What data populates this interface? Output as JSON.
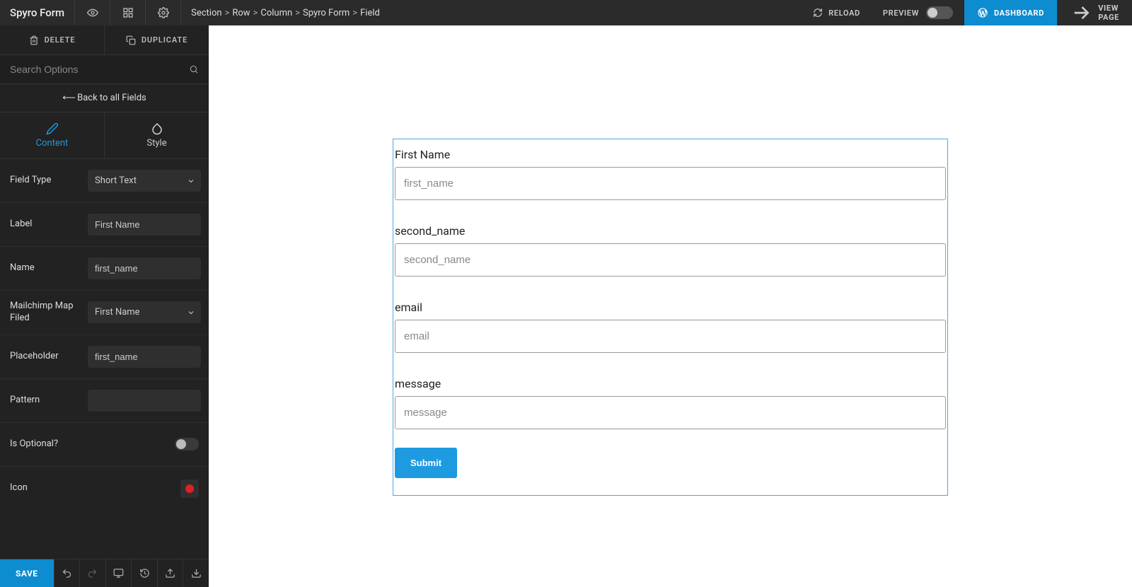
{
  "topbar": {
    "brand": "Spyro Form",
    "breadcrumb": [
      "Section",
      "Row",
      "Column",
      "Spyro Form",
      "Field"
    ],
    "reload": "RELOAD",
    "preview": "PREVIEW",
    "dashboard": "DASHBOARD",
    "view_page": "VIEW PAGE"
  },
  "sidebar": {
    "delete": "DELETE",
    "duplicate": "DUPLICATE",
    "search_placeholder": "Search Options",
    "back": "Back to all Fields",
    "tabs": {
      "content": "Content",
      "style": "Style"
    },
    "options": {
      "field_type": {
        "label": "Field Type",
        "value": "Short Text"
      },
      "label": {
        "label": "Label",
        "value": "First Name"
      },
      "name": {
        "label": "Name",
        "value": "first_name"
      },
      "mailchimp": {
        "label": "Mailchimp Map Filed",
        "value": "First Name"
      },
      "placeholder": {
        "label": "Placeholder",
        "value": "first_name"
      },
      "pattern": {
        "label": "Pattern",
        "value": ""
      },
      "optional": {
        "label": "Is Optional?"
      },
      "icon": {
        "label": "Icon"
      }
    }
  },
  "footer": {
    "save": "SAVE"
  },
  "form": {
    "fields": [
      {
        "label": "First Name",
        "placeholder": "first_name"
      },
      {
        "label": "second_name",
        "placeholder": "second_name"
      },
      {
        "label": "email",
        "placeholder": "email"
      },
      {
        "label": "message",
        "placeholder": "message"
      }
    ],
    "submit": "Submit"
  }
}
